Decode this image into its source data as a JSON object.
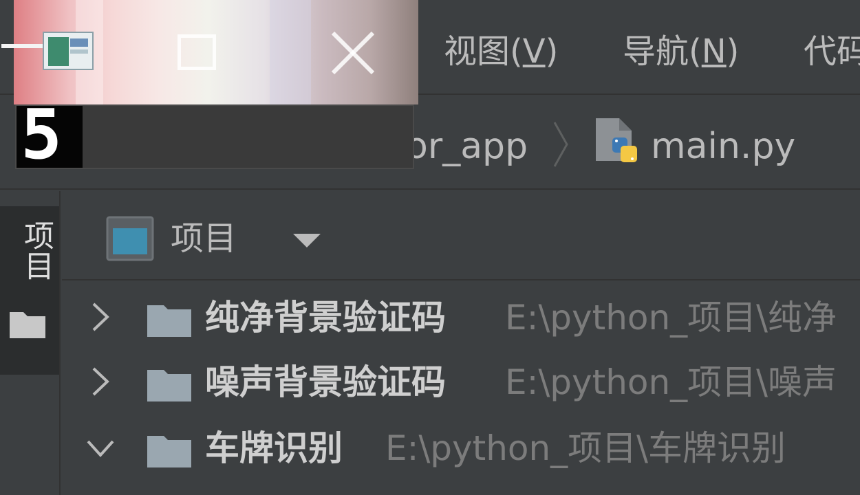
{
  "menu": {
    "items": [
      {
        "label": "视图(",
        "mnemonic": "V",
        "suffix": ")"
      },
      {
        "label": "导航(",
        "mnemonic": "N",
        "suffix": ")"
      },
      {
        "label": "代码",
        "mnemonic": "",
        "suffix": ""
      }
    ]
  },
  "breadcrumb": {
    "project": "or_app",
    "file": "main.py",
    "file_icon": "python-file-icon"
  },
  "overlay": {
    "captcha_digit": "5",
    "colors": {
      "gradient_start": "#de7f84",
      "gradient_end": "#8f807c"
    }
  },
  "toolstrip": {
    "project_tab_label": "项目"
  },
  "panel": {
    "title": "项目",
    "rows": [
      {
        "name": "纯净背景验证码",
        "path": "E:\\python_项目\\纯净",
        "expanded": false
      },
      {
        "name": "噪声背景验证码",
        "path": "E:\\python_项目\\噪声",
        "expanded": false
      },
      {
        "name": "车牌识别",
        "path": "E:\\python_项目\\车牌识别",
        "expanded": true
      }
    ]
  },
  "colors": {
    "background": "#3c3f41",
    "text": "#bbbbbb",
    "muted_text": "#7c7c7c",
    "folder": "#9aa7b0",
    "python_blue": "#3d79b4",
    "python_yellow": "#f4c844"
  }
}
